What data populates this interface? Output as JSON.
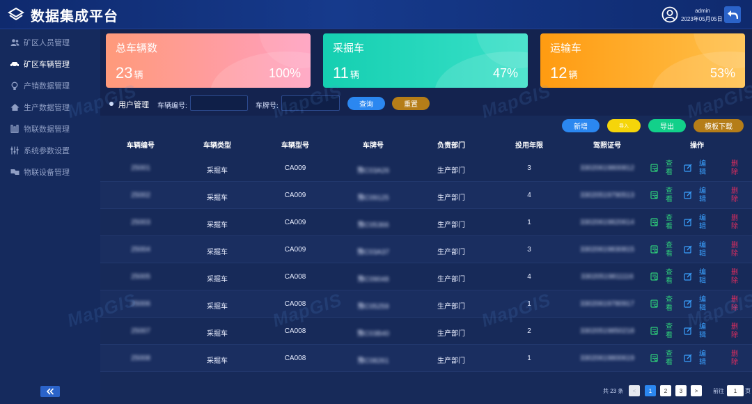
{
  "app": {
    "title": "数据集成平台"
  },
  "user": {
    "name": "admin",
    "date": "2023年05月05日"
  },
  "sidebar": {
    "items": [
      {
        "label": "矿区人员管理",
        "icon": "users-icon",
        "active": false
      },
      {
        "label": "矿区车辆管理",
        "icon": "car-icon",
        "active": true
      },
      {
        "label": "产销数据管理",
        "icon": "lightbulb-icon",
        "active": false
      },
      {
        "label": "生产数据管理",
        "icon": "house-icon",
        "active": false
      },
      {
        "label": "物联数据管理",
        "icon": "building-icon",
        "active": false
      },
      {
        "label": "系统参数设置",
        "icon": "sliders-icon",
        "active": false
      },
      {
        "label": "物联设备管理",
        "icon": "flag-icon",
        "active": false
      }
    ]
  },
  "cards": [
    {
      "label": "总车辆数",
      "count": "23",
      "unit": "辆",
      "percent": "100%",
      "from": "#ff9a7a",
      "to": "#ff9fbf"
    },
    {
      "label": "采掘车",
      "count": "11",
      "unit": "辆",
      "percent": "47%",
      "from": "#15cfb1",
      "to": "#39e0c8"
    },
    {
      "label": "运输车",
      "count": "12",
      "unit": "辆",
      "percent": "53%",
      "from": "#ff9b11",
      "to": "#ffc04a"
    }
  ],
  "filter": {
    "title": "用户管理",
    "vehicle_no_label": "车辆编号:",
    "plate_label": "车牌号:",
    "search_label": "查询",
    "reset_label": "重置"
  },
  "toolbar": {
    "add_label": "新增",
    "import_label": "导入",
    "export_label": "导出",
    "template_label": "模板下载"
  },
  "table": {
    "headers": [
      "车辆编号",
      "车辆类型",
      "车辆型号",
      "车牌号",
      "负责部门",
      "投用年限",
      "驾照证号",
      "操作"
    ],
    "rows": [
      {
        "id": "25001",
        "type": "采掘车",
        "model": "CA009",
        "plate": "豫C03A26",
        "dept": "生产部门",
        "years": "3",
        "license": "33020619800812"
      },
      {
        "id": "25002",
        "type": "采掘车",
        "model": "CA009",
        "plate": "豫C09125",
        "dept": "生产部门",
        "years": "4",
        "license": "33020519790513"
      },
      {
        "id": "25003",
        "type": "采掘车",
        "model": "CA009",
        "plate": "豫C05366",
        "dept": "生产部门",
        "years": "1",
        "license": "33020619820614"
      },
      {
        "id": "25004",
        "type": "采掘车",
        "model": "CA009",
        "plate": "豫C03A37",
        "dept": "生产部门",
        "years": "3",
        "license": "33020619830815"
      },
      {
        "id": "25005",
        "type": "采掘车",
        "model": "CA008",
        "plate": "豫C09048",
        "dept": "生产部门",
        "years": "4",
        "license": "33020519811116"
      },
      {
        "id": "25006",
        "type": "采掘车",
        "model": "CA008",
        "plate": "豫C05259",
        "dept": "生产部门",
        "years": "1",
        "license": "33020619780917"
      },
      {
        "id": "25007",
        "type": "采掘车",
        "model": "CA008",
        "plate": "豫C03B40",
        "dept": "生产部门",
        "years": "2",
        "license": "33020519850218"
      },
      {
        "id": "25008",
        "type": "采掘车",
        "model": "CA008",
        "plate": "豫C08261",
        "dept": "生产部门",
        "years": "1",
        "license": "33020619800619"
      }
    ],
    "actions": {
      "view": "查看",
      "edit": "编辑",
      "delete": "删除"
    }
  },
  "pagination": {
    "total": "共 23 条",
    "pages": [
      "1",
      "2",
      "3"
    ],
    "current": "1",
    "goto_label": "前往",
    "goto_value": "1",
    "unit": "页",
    "prev": "<",
    "next": ">"
  }
}
